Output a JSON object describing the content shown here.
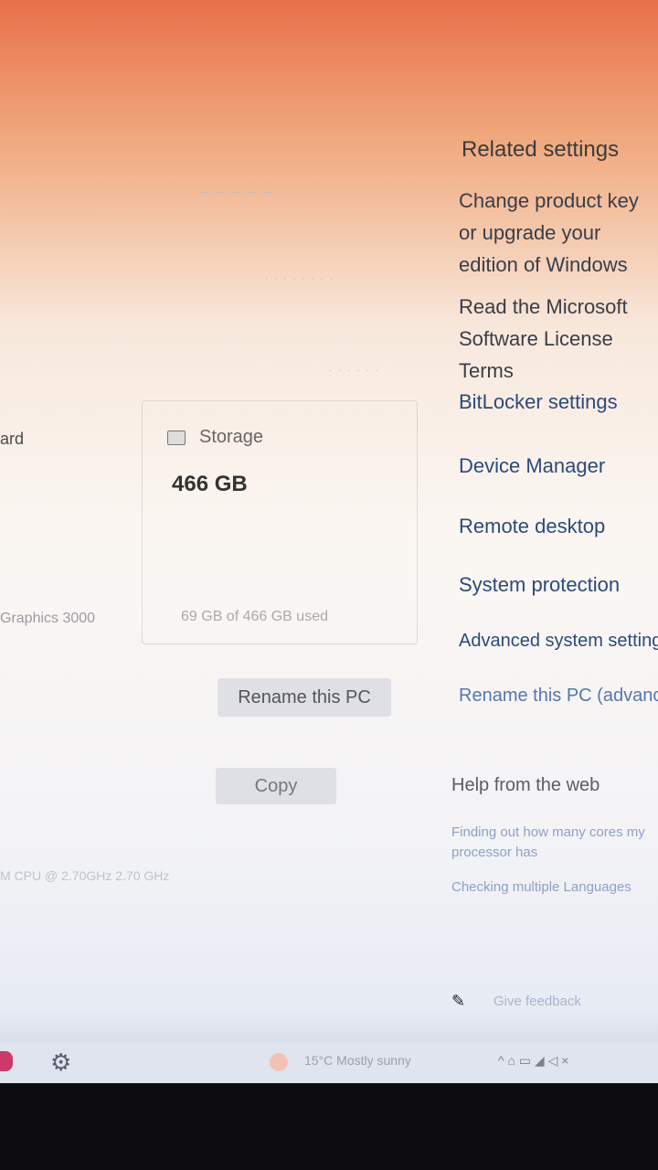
{
  "left": {
    "partial_label": "ard",
    "graphics": "Graphics 3000",
    "cpu": "M CPU @ 2.70GHz   2.70 GHz"
  },
  "storage": {
    "label": "Storage",
    "value": "466 GB",
    "used": "69 GB of 466 GB used"
  },
  "buttons": {
    "rename": "Rename this PC",
    "copy": "Copy"
  },
  "related": {
    "title": "Related settings",
    "links": [
      "Change product key or upgrade your edition of Windows",
      "Read the Microsoft Software License Terms",
      "BitLocker settings",
      "Device Manager",
      "Remote desktop",
      "System protection",
      "Advanced system settings",
      "Rename this PC (advanced)"
    ]
  },
  "help": {
    "title": "Help from the web",
    "links": [
      "Finding out how many cores my processor has",
      "Checking multiple Languages"
    ]
  },
  "feedback": {
    "label": "Give feedback"
  },
  "taskbar": {
    "weather": "15°C  Mostly sunny",
    "tray": "^ ⌂ ▭ ◢ ◁ ×"
  },
  "icons": {
    "gear": "gear-icon",
    "storage": "drive-icon",
    "feedback": "feedback-icon"
  }
}
